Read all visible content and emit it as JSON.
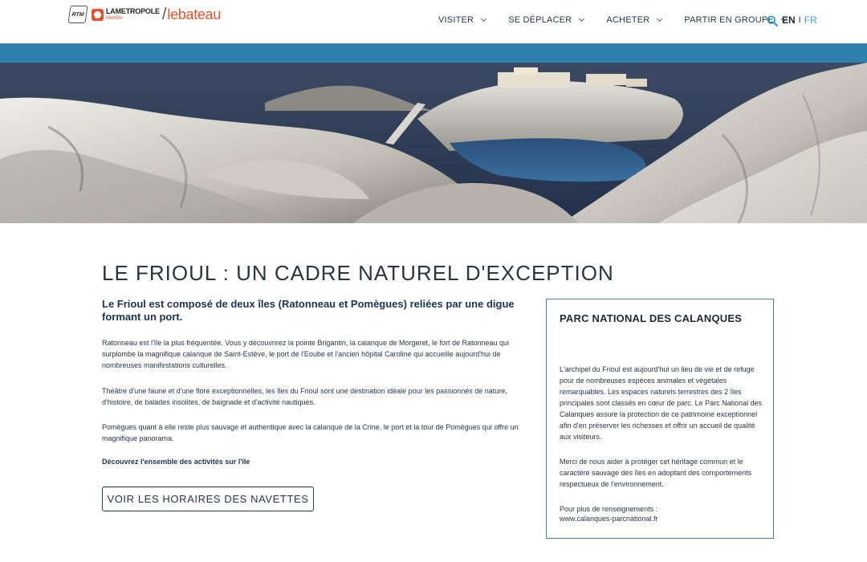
{
  "header": {
    "logo": {
      "rtm": "RTM",
      "metropole": "LAMETROPOLE",
      "mobilite": "Mobilité",
      "slash": "/",
      "bateau": "lebateau"
    },
    "nav": [
      {
        "label": "VISITER"
      },
      {
        "label": "SE DÉPLACER"
      },
      {
        "label": "ACHETER"
      },
      {
        "label": "PARTIR EN GROUPE"
      }
    ],
    "lang": {
      "en": "EN",
      "sep": "I",
      "fr": "FR"
    }
  },
  "main": {
    "title": "LE FRIOUL : UN CADRE NATUREL D'EXCEPTION",
    "intro": "Le Frioul est composé de deux îles (Ratonneau et Pomègues) reliées par une digue formant un port.",
    "paragraphs": [
      "Ratonneau est l'île la plus fréquentée. Vous y découvrirez la pointe Brigantin, la calanque de Morgeret, le fort de Ratonneau qui surplombe la magnifique calanque de Saint-Estève, le port de l'Eoube et l'ancien hôpital Caroline qui accueille aujourd'hui de nombreuses manifestations culturelles.",
      "Théâtre d'une faune et d'une flore exceptionnelles, les îles du Frioul sont une destination idéale pour les passionnés de nature, d'histoire, de balades insolites, de baignade et d'activité nautiques.",
      "Pomègues quant à elle reste plus sauvage et authentique avec  la calanque de la Crine, le port et la tour de Pomègues qui offre un magnifique panorama."
    ],
    "discover_link": "Découvrez l'ensemble des activités sur l'île",
    "shuttle_button": "VOIR LES HORAIRES DES NAVETTES"
  },
  "sidebar": {
    "title": "PARC NATIONAL DES CALANQUES",
    "paragraphs": [
      "L'archipel du Frioul est aujourd'hui un lieu de vie et de refuge pour de nombreuses espèces animales et végétales remarquables. Les espaces naturels terrestres des 2  îles principales sont classés en cœur de parc. Le Parc National des Calanques assure la protection de ce patrimoine exceptionnel afin d'en préserver les richesses et offrir un accueil de qualité aux visiteurs.",
      "Merci de nous aider à protéger cet héritage commun et le caractère sauvage des îles en adoptant des comportements respectueux de l'environnement.",
      "Pour plus de renseignements :"
    ],
    "link": "www.calanques-parcnational.fr"
  },
  "colors": {
    "accent_blue": "#2e80ad",
    "brand_orange": "#e3522b",
    "text_dark": "#1b3350",
    "lang_active": "#3aa0d8",
    "box_border": "#4f7fa0"
  },
  "icons": {
    "search": "search-icon",
    "chevron": "chevron-down-icon"
  }
}
